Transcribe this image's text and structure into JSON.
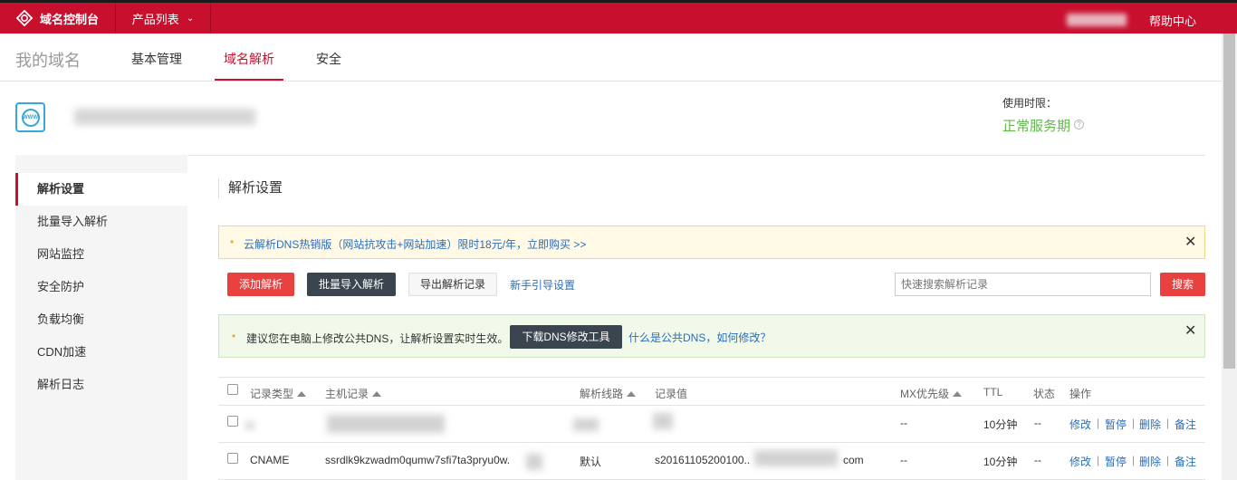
{
  "topbar": {
    "brand": "域名控制台",
    "product_menu": "产品列表",
    "help": "帮助中心",
    "color": "#c8102e"
  },
  "subnav": {
    "my_domain": "我的域名",
    "tabs": [
      "基本管理",
      "域名解析",
      "安全"
    ],
    "active_tab": "域名解析"
  },
  "domain_info": {
    "expire_label": "使用时限：",
    "expire_status": "正常服务期",
    "status_color": "#62b84a"
  },
  "sidebar": {
    "items": [
      "解析设置",
      "批量导入解析",
      "网站监控",
      "安全防护",
      "负载均衡",
      "CDN加速",
      "解析日志"
    ],
    "active": "解析设置"
  },
  "main": {
    "title": "解析设置",
    "promo": "云解析DNS热销版（网站抗攻击+网站加速）限时18元/年，立即购买 >>",
    "buttons": {
      "add": "添加解析",
      "import": "批量导入解析",
      "export": "导出解析记录",
      "guide": "新手引导设置",
      "search": "搜索"
    },
    "search_placeholder": "快速搜索解析记录",
    "dns_notice": {
      "text": "建议您在电脑上修改公共DNS，让解析设置实时生效。",
      "download_button": "下载DNS修改工具",
      "link": "什么是公共DNS，如何修改？"
    }
  },
  "table": {
    "headers": [
      "记录类型",
      "主机记录",
      "解析线路",
      "记录值",
      "MX优先级",
      "TTL",
      "状态",
      "操作"
    ],
    "rows": [
      {
        "type": "",
        "host": "",
        "line": "",
        "value": "",
        "mx": "--",
        "ttl": "10分钟",
        "status": "--",
        "ops": [
          "修改",
          "暂停",
          "删除",
          "备注"
        ]
      },
      {
        "type": "CNAME",
        "host": "ssrdlk9kzwadm0qumw7sfi7ta3pryu0w.",
        "line": "默认",
        "value_prefix": "s20161105200100..",
        "value_suffix": "com",
        "mx": "--",
        "ttl": "10分钟",
        "status": "--",
        "ops": [
          "修改",
          "暂停",
          "删除",
          "备注"
        ]
      }
    ]
  }
}
